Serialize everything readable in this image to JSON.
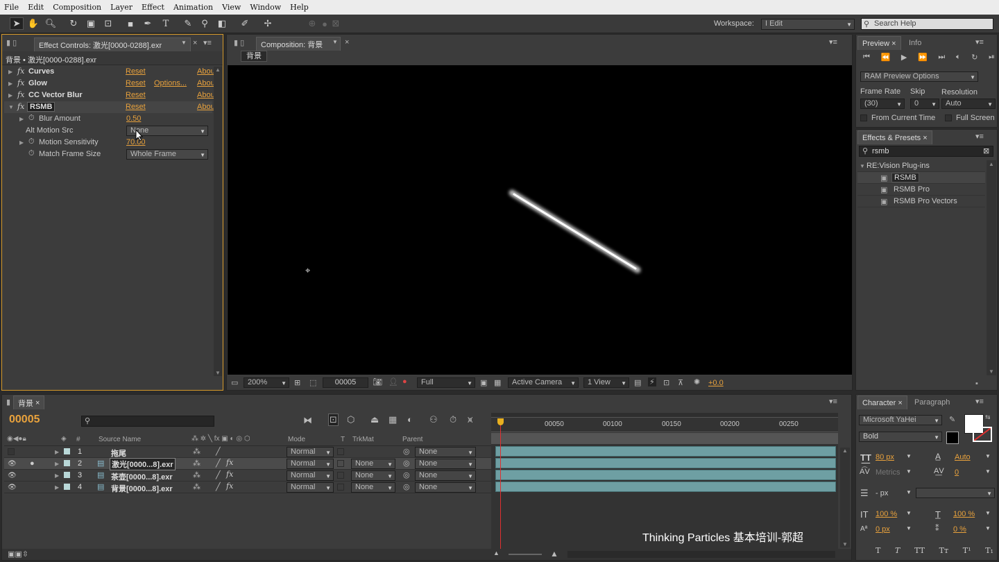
{
  "menu": [
    "File",
    "Edit",
    "Composition",
    "Layer",
    "Effect",
    "Animation",
    "View",
    "Window",
    "Help"
  ],
  "workspace": {
    "label": "Workspace:",
    "value": "I Edit"
  },
  "search_help": "Search Help",
  "effect_controls": {
    "tab": "Effect Controls: 激光[0000-0288].exr",
    "subtitle": "背景 • 激光[0000-0288].exr",
    "effects": [
      {
        "name": "Curves",
        "reset": "Reset",
        "about": "Abou"
      },
      {
        "name": "Glow",
        "reset": "Reset",
        "options": "Options...",
        "about": "Abou"
      },
      {
        "name": "CC Vector Blur",
        "reset": "Reset",
        "about": "Abou"
      },
      {
        "name": "RSMB",
        "reset": "Reset",
        "about": "Abou"
      }
    ],
    "params": [
      {
        "name": "Blur Amount",
        "value": "0.50"
      },
      {
        "name": "Alt Motion Src",
        "value": "None"
      },
      {
        "name": "Motion Sensitivity",
        "value": "70.00"
      },
      {
        "name": "Match Frame Size",
        "value": "Whole Frame"
      }
    ]
  },
  "composition": {
    "tab": "Composition: 背景",
    "layer_tab": "背景",
    "zoom": "200%",
    "frame": "00005",
    "resolution": "Full",
    "camera": "Active Camera",
    "view": "1 View",
    "exposure": "+0.0"
  },
  "preview": {
    "tabs": [
      "Preview",
      "Info"
    ],
    "ram": "RAM Preview Options",
    "frame_rate_label": "Frame Rate",
    "skip_label": "Skip",
    "resolution_label": "Resolution",
    "frame_rate": "(30)",
    "skip": "0",
    "resolution": "Auto",
    "from_current": "From Current Time",
    "full_screen": "Full Screen"
  },
  "effects_presets": {
    "tab": "Effects & Presets",
    "search": "rsmb",
    "category": "RE:Vision Plug-ins",
    "items": [
      "RSMB",
      "RSMB Pro",
      "RSMB Pro Vectors"
    ]
  },
  "timeline": {
    "tab": "背景",
    "timecode": "00005",
    "headers": {
      "num": "#",
      "source": "Source Name",
      "mode": "Mode",
      "t": "T",
      "trkmat": "TrkMat",
      "parent": "Parent"
    },
    "ruler": [
      "00050",
      "00100",
      "00150",
      "00200",
      "00250"
    ],
    "layers": [
      {
        "num": "1",
        "name": "拖尾",
        "mode": "Normal",
        "trkmat": "",
        "parent": "None"
      },
      {
        "num": "2",
        "name": "激光[0000...8].exr",
        "mode": "Normal",
        "trkmat": "None",
        "parent": "None"
      },
      {
        "num": "3",
        "name": "茶壶[0000...8].exr",
        "mode": "Normal",
        "trkmat": "None",
        "parent": "None"
      },
      {
        "num": "4",
        "name": "背景[0000...8].exr",
        "mode": "Normal",
        "trkmat": "None",
        "parent": "None"
      }
    ],
    "watermark": "Thinking Particles 基本培训-郭超"
  },
  "character": {
    "tabs": [
      "Character",
      "Paragraph"
    ],
    "font": "Microsoft YaHei",
    "style": "Bold",
    "size": "80 px",
    "leading": "Auto",
    "kerning": "Metrics",
    "tracking": "0",
    "stroke": "- px",
    "vscale": "100 %",
    "hscale": "100 %",
    "baseline": "0 px",
    "tsume": "0 %"
  }
}
